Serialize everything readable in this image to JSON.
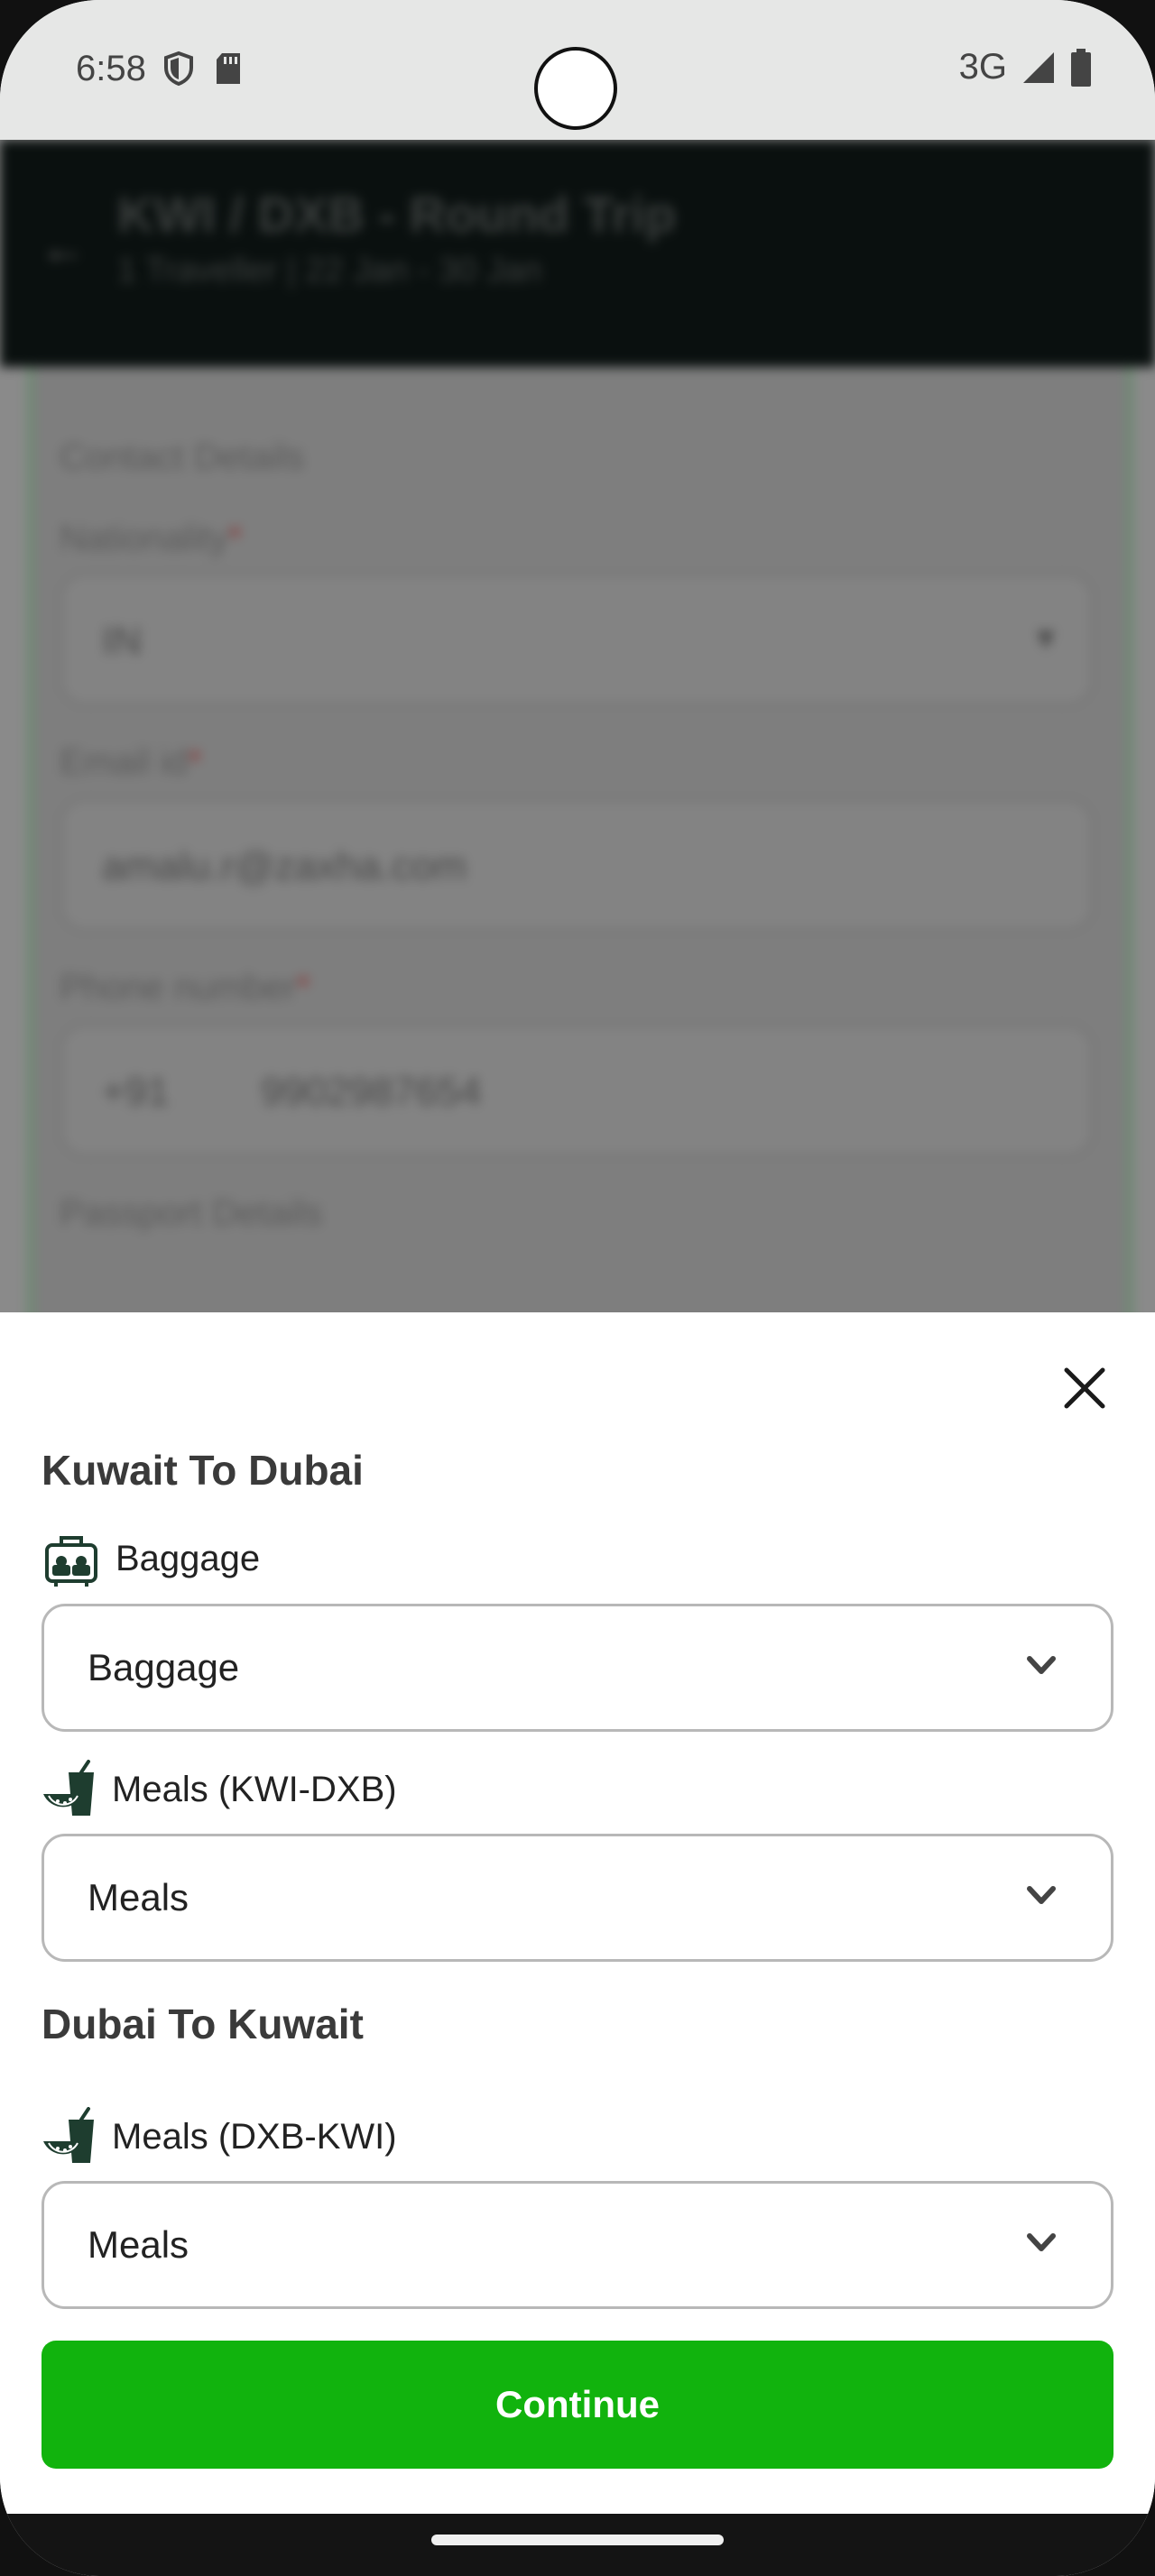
{
  "status_bar": {
    "time": "6:58",
    "network": "3G"
  },
  "background_page": {
    "title": "KWI / DXB - Round Trip",
    "subtitle": "1 Traveller | 22 Jan - 30 Jan",
    "sections": [
      "Contact Details",
      "Passport Details"
    ],
    "fields": [
      {
        "label": "Nationality",
        "value": "IN"
      },
      {
        "label": "Email id",
        "value": "amalu.r@zaxha.com"
      },
      {
        "label": "Phone number",
        "code": "+91",
        "value": "9902987654"
      }
    ]
  },
  "sheet": {
    "segments": [
      {
        "title": "Kuwait To Dubai",
        "fields": [
          {
            "label": "Baggage",
            "icon": "baggage-icon",
            "value": "Baggage"
          },
          {
            "label": "Meals (KWI-DXB)",
            "icon": "meal-icon",
            "value": "Meals"
          }
        ]
      },
      {
        "title": "Dubai To Kuwait",
        "fields": [
          {
            "label": "Meals (DXB-KWI)",
            "icon": "meal-icon",
            "value": "Meals"
          }
        ]
      }
    ],
    "continue_label": "Continue"
  },
  "colors": {
    "accent": "#11b30d",
    "app_bar": "#0a100f",
    "status_bar": "#e6e7e6"
  }
}
